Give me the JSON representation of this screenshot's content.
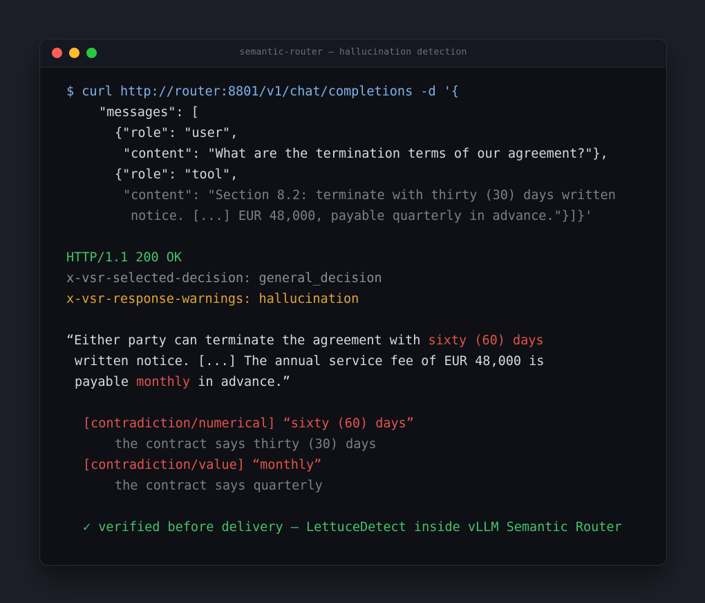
{
  "window": {
    "title": "semantic-router — hallucination detection"
  },
  "request": {
    "prompt": "$",
    "command": "curl http://router:8801/v1/chat/completions -d '{",
    "line_messages": "\"messages\": [",
    "line_role_user": "{\"role\": \"user\",",
    "line_content_user": "\"content\": \"What are the termination terms of our agreement?\"},",
    "line_role_tool": "{\"role\": \"tool\",",
    "line_content_tool_1": "\"content\": \"Section 8.2: terminate with thirty (30) days written",
    "line_content_tool_2": "notice. [...] EUR 48,000, payable quarterly in advance.\"}]}'"
  },
  "response": {
    "status": "HTTP/1.1 200 OK",
    "header_decision": "x-vsr-selected-decision: general_decision",
    "header_warnings_key": "x-vsr-response-warnings:",
    "header_warnings_value": "hallucination"
  },
  "answer": {
    "l1_a": "“Either party can terminate the agreement with ",
    "l1_flag": "sixty (60) days",
    "l2": "written notice. [...] The annual service fee of EUR 48,000 is",
    "l3_a": "payable ",
    "l3_flag": "monthly",
    "l3_b": " in advance.”"
  },
  "findings": [
    {
      "label": "[contradiction/numerical] “sixty (60) days”",
      "note": "the contract says thirty (30) days"
    },
    {
      "label": "[contradiction/value] “monthly”",
      "note": "the contract says quarterly"
    }
  ],
  "footer": {
    "check": "✓",
    "text": "verified before delivery — LettuceDetect inside vLLM Semantic Router"
  },
  "colors": {
    "background": "#1c1f27",
    "terminal": "#0e1016",
    "command_blue": "#7fb3ea",
    "status_green": "#46c26a",
    "warning_orange": "#e3a536",
    "hallucination_red": "#e5534b",
    "dim_gray": "#7b808b"
  }
}
